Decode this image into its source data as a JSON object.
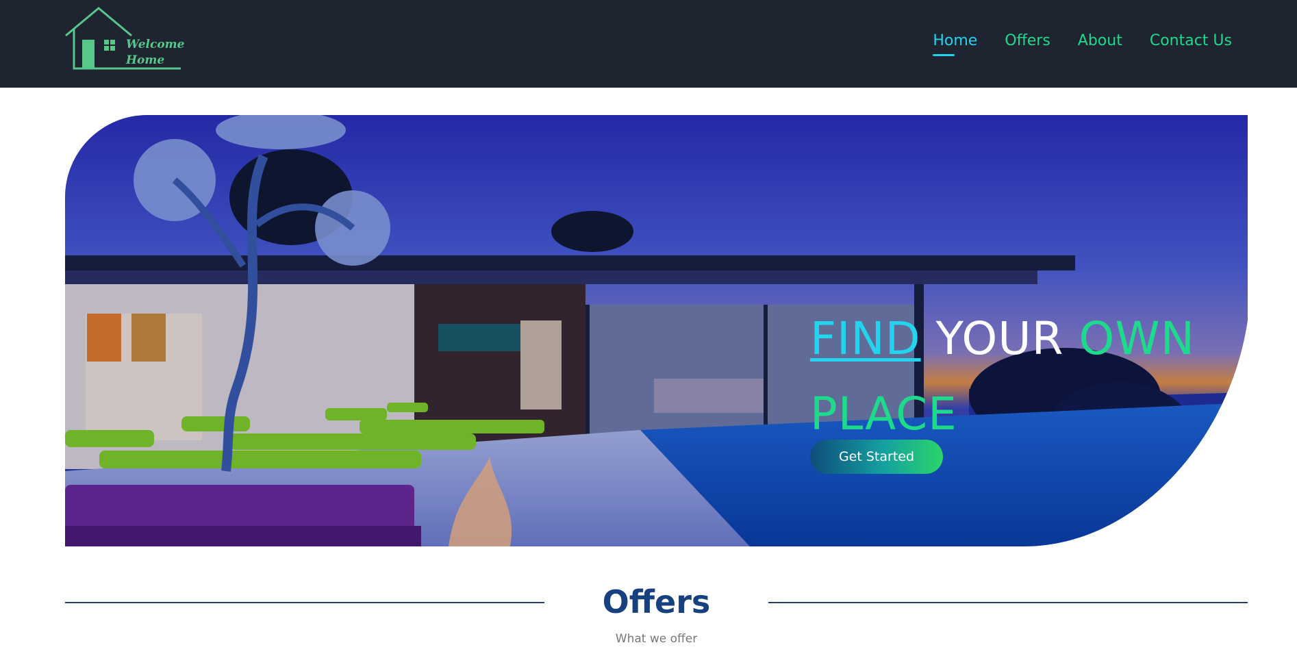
{
  "header": {
    "logo": {
      "line1": "Welcome",
      "line2": "Home"
    },
    "nav": [
      {
        "label": "Home",
        "active": true
      },
      {
        "label": "Offers",
        "active": false
      },
      {
        "label": "About",
        "active": false
      },
      {
        "label": "Contact Us",
        "active": false
      }
    ]
  },
  "hero": {
    "title": {
      "word1": "FIND",
      "word2": "YOUR",
      "word3": "OWN",
      "word4": "PLACE"
    },
    "cta_label": "Get Started"
  },
  "offers_section": {
    "title": "Offers",
    "subtitle": "What we offer"
  },
  "colors": {
    "header_bg": "#1e2430",
    "nav_text": "#1edb8c",
    "nav_active": "#22d4ee",
    "heading_blue": "#17407e"
  },
  "icons": [
    "house-logo-icon"
  ]
}
